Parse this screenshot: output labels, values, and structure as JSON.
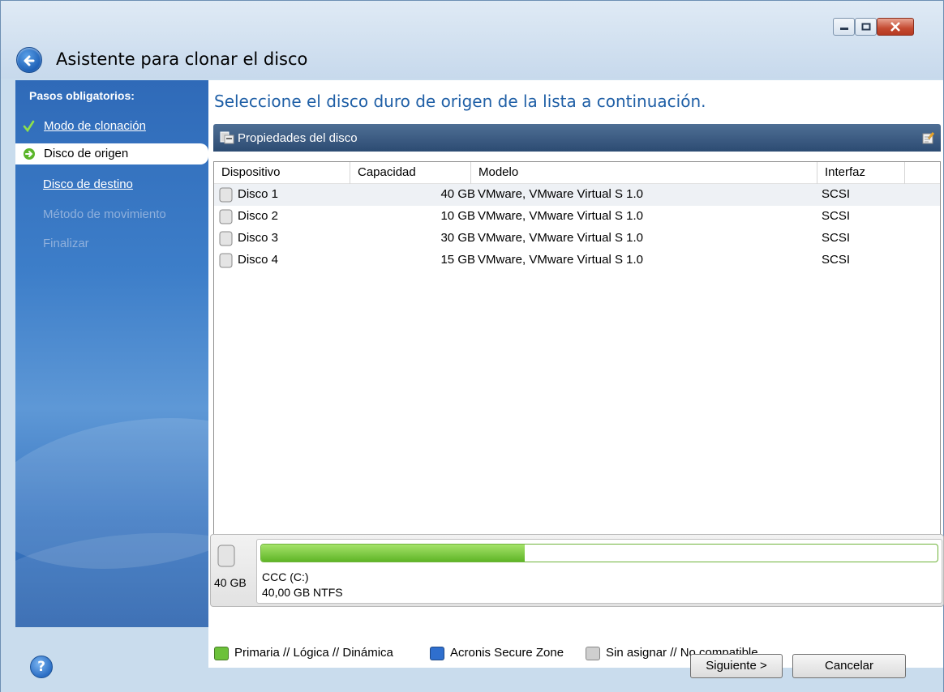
{
  "window": {
    "title": "Asistente para clonar el disco",
    "controls": [
      "minimize-icon",
      "maximize-icon",
      "close-icon"
    ]
  },
  "sidebar": {
    "heading": "Pasos obligatorios:",
    "items": [
      {
        "label": "Modo de clonación",
        "state": "done",
        "icon": "checkmark-icon"
      },
      {
        "label": "Disco de origen",
        "state": "active",
        "icon": "arrow-right-icon"
      },
      {
        "label": "Disco de destino",
        "state": "link"
      },
      {
        "label": "Método de movimiento",
        "state": "disabled"
      },
      {
        "label": "Finalizar",
        "state": "disabled"
      }
    ]
  },
  "main": {
    "heading": "Seleccione el disco duro de origen de la lista a continuación.",
    "panel_title": "Propiedades del disco",
    "columns": [
      "Dispositivo",
      "Capacidad",
      "Modelo",
      "Interfaz"
    ],
    "rows": [
      {
        "device": "Disco 1",
        "capacity": "40 GB",
        "model": "VMware, VMware Virtual S 1.0",
        "interface": "SCSI"
      },
      {
        "device": "Disco 2",
        "capacity": "10 GB",
        "model": "VMware, VMware Virtual S 1.0",
        "interface": "SCSI"
      },
      {
        "device": "Disco 3",
        "capacity": "30 GB",
        "model": "VMware, VMware Virtual S 1.0",
        "interface": "SCSI"
      },
      {
        "device": "Disco 4",
        "capacity": "15 GB",
        "model": "VMware, VMware Virtual S 1.0",
        "interface": "SCSI"
      }
    ]
  },
  "diskmap": {
    "disk_size": "40 GB",
    "partition_name": "CCC (C:)",
    "partition_info": "40,00 GB  NTFS",
    "used_fraction": 0.39
  },
  "legend": [
    {
      "label": "Primaria // Lógica // Dinámica",
      "color": "#6cc13a"
    },
    {
      "label": "Acronis Secure Zone",
      "color": "#2f6fce"
    },
    {
      "label": "Sin asignar // No compatible",
      "color": "#cfcfcf"
    }
  ],
  "buttons": {
    "next": "Siguiente >",
    "cancel": "Cancelar"
  }
}
